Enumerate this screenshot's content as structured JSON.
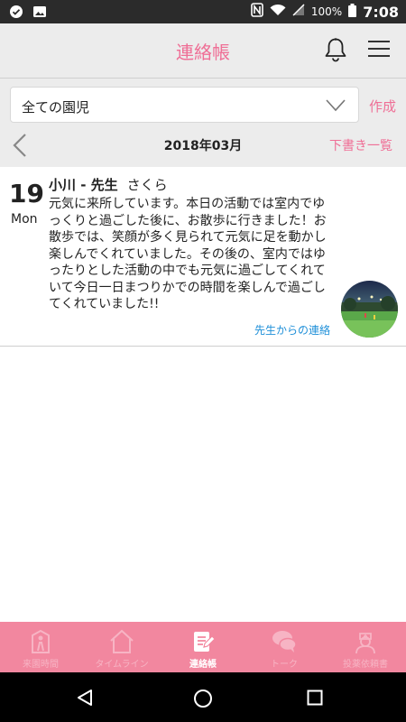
{
  "status_bar": {
    "battery": "100%",
    "time": "7:08"
  },
  "header": {
    "title": "連絡帳"
  },
  "filter": {
    "selected": "全ての園児",
    "create_label": "作成"
  },
  "month_nav": {
    "month": "2018年03月",
    "drafts_label": "下書き一覧"
  },
  "entry": {
    "day": "19",
    "weekday": "Mon",
    "teacher": "小川 - 先生",
    "child": "さくら",
    "body": "元気に来所しています。本日の活動では室内でゆっくりと過ごした後に、お散歩に行きました！お散歩では、笑顔が多く見られて元気に足を動かし楽しんでくれていました。その後の、室内ではゆったりとした活動の中でも元気に過ごしてくれていて今日一日まつりかでの時間を楽しんで過ごしてくれていました!!",
    "source_label": "先生からの連絡"
  },
  "tabs": [
    {
      "label": "来園時間",
      "icon": "arrival-icon",
      "active": false
    },
    {
      "label": "タイムライン",
      "icon": "home-icon",
      "active": false
    },
    {
      "label": "連絡帳",
      "icon": "notebook-icon",
      "active": true
    },
    {
      "label": "トーク",
      "icon": "chat-icon",
      "active": false
    },
    {
      "label": "投薬依頼書",
      "icon": "nurse-icon",
      "active": false
    }
  ],
  "colors": {
    "accent": "#ef6f96",
    "tab_bar": "#f2879f",
    "link": "#1e8fd8",
    "header_bg": "#ececec"
  }
}
